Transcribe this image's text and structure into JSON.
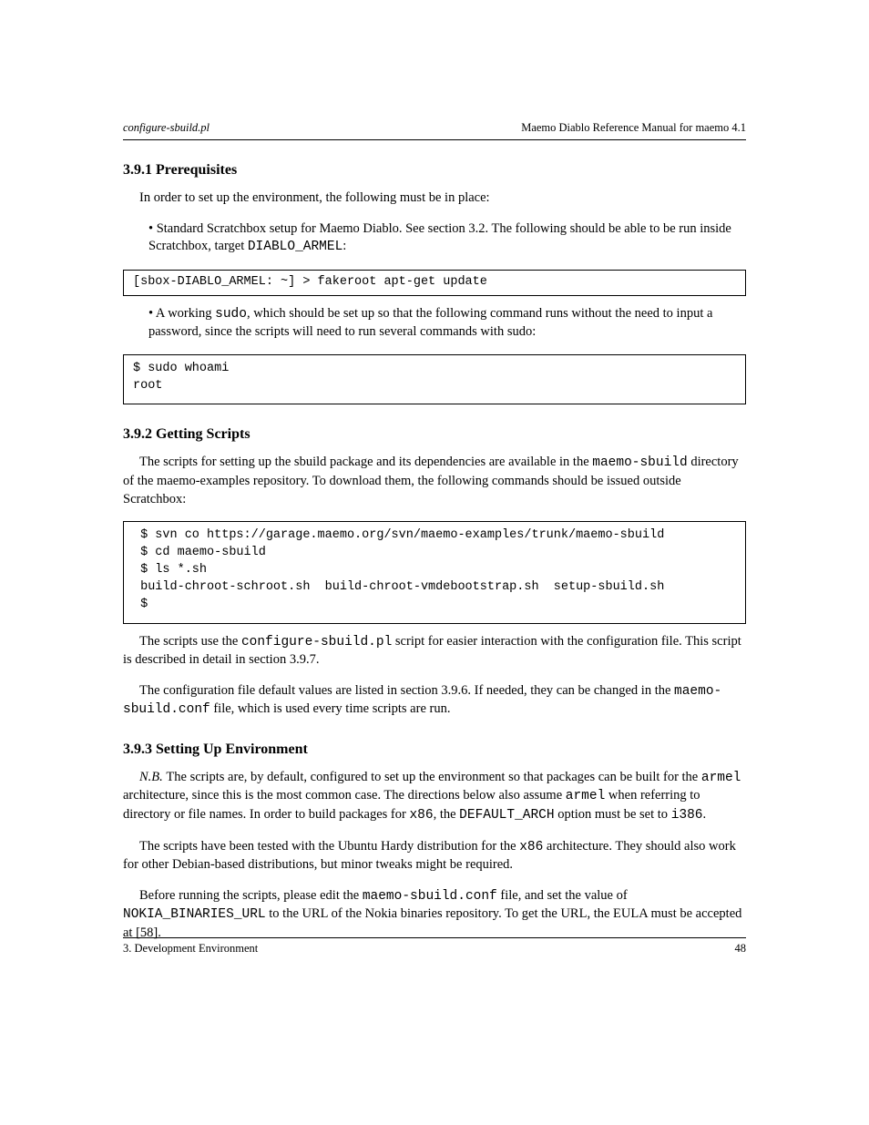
{
  "header": {
    "left": "configure-sbuild.pl",
    "right": "Maemo Diablo Reference Manual for maemo 4.1"
  },
  "section1": {
    "title": "3.9.1   Prerequisites",
    "p1": "In order to set up the environment, the following must be in place:",
    "b1_prefix": "• Standard Scratchbox setup for Maemo Diablo. See section 3.2. The following should be able to be run inside Scratchbox, target ",
    "b1_code": "DIABLO_ARMEL",
    "b1_suffix": ":",
    "code1": "[sbox-DIABLO_ARMEL: ~] > fakeroot apt-get update",
    "b2_prefix": "• A working ",
    "b2_code": "sudo",
    "b2_suffix": ", which should be set up so that the following command runs without the need to input a password, since the scripts will need to run several commands with sudo:",
    "code2_l1": "$ sudo whoami",
    "code2_l2": "root"
  },
  "section2": {
    "title": "3.9.2   Getting Scripts",
    "p1_a": "The scripts for setting up the sbuild package and its dependencies are available in the ",
    "p1_b": "maemo-sbuild",
    "p1_c": " directory of the maemo-examples repository. To download them, the following commands should be issued outside Scratchbox:",
    "code_block": " $ svn co https://garage.maemo.org/svn/maemo-examples/trunk/maemo-sbuild\n $ cd maemo-sbuild\n $ ls *.sh\n build-chroot-schroot.sh  build-chroot-vmdebootstrap.sh  setup-sbuild.sh\n $",
    "p2_a": "The scripts use the ",
    "p2_b": "configure-sbuild.pl",
    "p2_c": " script for easier interaction with the configuration file. This script is described in detail in section 3.9.7.",
    "p3_a": "The configuration file default values are listed in section 3.9.6. If needed, they can be changed in the ",
    "p3_b": "maemo-sbuild.conf",
    "p3_c": " file, which is used every time scripts are run."
  },
  "section3": {
    "title": "3.9.3   Setting Up Environment",
    "p1_a": "N.B. ",
    "p1_b": "The scripts are, by default, configured to set up the environment so that packages can be built for the ",
    "p1_c": "armel",
    "p1_d": " architecture, since this is the most common case. The directions below also assume ",
    "p1_e": "armel",
    "p1_f": " when referring to directory or file names. In order to build packages for ",
    "p1_g": "x86",
    "p1_h": ", the ",
    "p1_i": "DEFAULT_ARCH",
    "p1_j": " option must be set to ",
    "p1_k": "i386",
    "p1_l": ".",
    "p2_a": "The scripts have been tested with the Ubuntu Hardy distribution for the ",
    "p2_b": "x86",
    "p2_c": " architecture. They should also work for other Debian-based distributions, but minor tweaks might be required.",
    "p3_a": "Before running the scripts, please edit the ",
    "p3_b": "maemo-sbuild.conf",
    "p3_c": " file, and set the value of ",
    "p3_d": "NOKIA_BINARIES_URL",
    "p3_e": " to the URL of the Nokia binaries repository. To get the URL, the EULA must be accepted at [58]."
  },
  "footer": {
    "left": "3. Development Environment",
    "right": "48"
  }
}
